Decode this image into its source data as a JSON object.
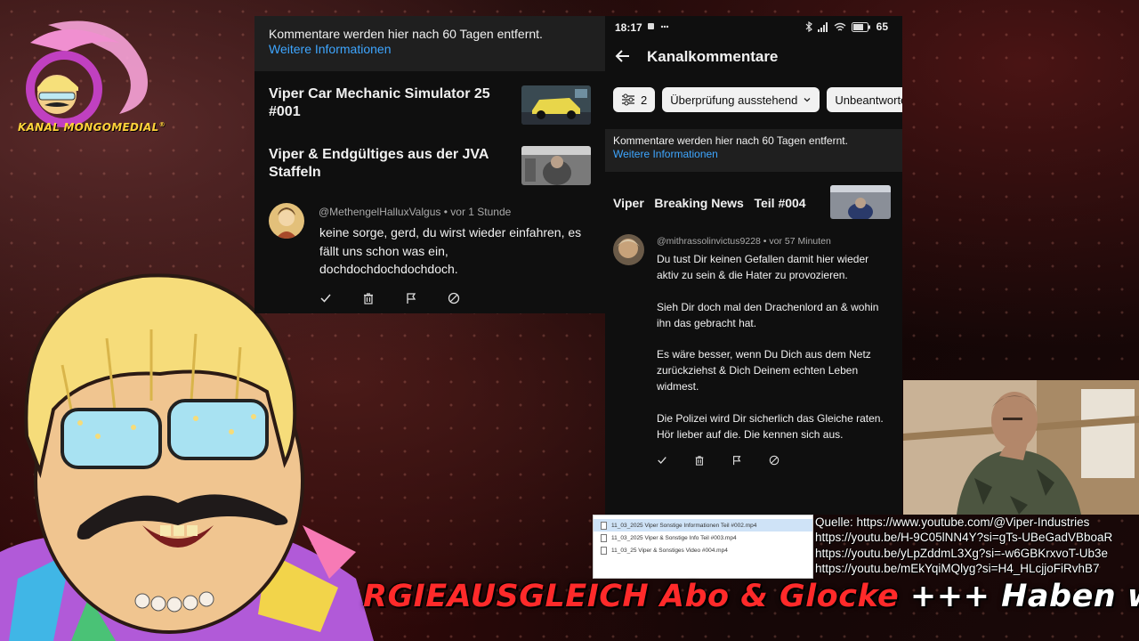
{
  "overlay": {
    "logo_text": "KANAL MONGOMEDIAL",
    "logo_reg": "®",
    "ticker_red": "RGIEAUSGLEICH Abo & Glocke",
    "ticker_white": " +++ Haben wi",
    "sources": [
      "Quelle: https://www.youtube.com/@Viper-Industries",
      "https://youtu.be/H-9C05lNN4Y?si=gTs-UBeGadVBboaR",
      "https://youtu.be/yLpZddmL3Xg?si=-w6GBKrxvoT-Ub3e",
      "https://youtu.be/mEkYqiMQlyg?si=H4_HLcjjoFiRvhB7"
    ],
    "files": [
      "11_03_2025 Viper   Sonstige Informationen Teil #002.mp4",
      "11_03_2025 Viper & Sonstige Info Teil #003.mp4",
      "11_03_25 Viper & Sonstiges Video #004.mp4"
    ]
  },
  "left_panel": {
    "notice_text": "Kommentare werden hier nach 60 Tagen entfernt.",
    "notice_link": "Weitere Informationen",
    "videos": [
      {
        "title": "Viper   Car Mechanic Simulator 25 #001"
      },
      {
        "title": "Viper & Endgültiges aus der JVA Staffeln"
      }
    ],
    "comment": {
      "author": "@MethengelHalluxValgus",
      "time": "vor 1 Stunde",
      "lines": [
        "keine sorge, gerd, du wirst wieder einfahren, es",
        "fällt uns schon was ein,",
        "dochdochdochdochdoch."
      ]
    }
  },
  "right_panel": {
    "status": {
      "time": "18:17",
      "battery": "65"
    },
    "title": "Kanalkommentare",
    "filter_count": "2",
    "chips": [
      "Überprüfung ausstehend",
      "Unbeantwortete"
    ],
    "notice_text": "Kommentare werden hier nach 60 Tagen entfernt.",
    "notice_link": "Weitere Informationen",
    "video_title": "Viper   Breaking News   Teil #004",
    "comment": {
      "author": "@mithrassolinvictus9228",
      "time": "vor 57 Minuten",
      "lines": [
        "Du tust Dir keinen Gefallen damit hier wieder",
        "aktiv zu sein & die Hater zu provozieren.",
        "",
        "Sieh Dir doch mal den Drachenlord an & wohin",
        "ihn das gebracht hat.",
        "",
        "Es wäre besser, wenn Du Dich aus dem Netz",
        "zurückziehst & Dich Deinem echten Leben",
        "widmest.",
        "",
        "Die Polizei wird Dir sicherlich das Gleiche raten.",
        "Hör lieber auf die. Die kennen sich aus."
      ]
    }
  }
}
